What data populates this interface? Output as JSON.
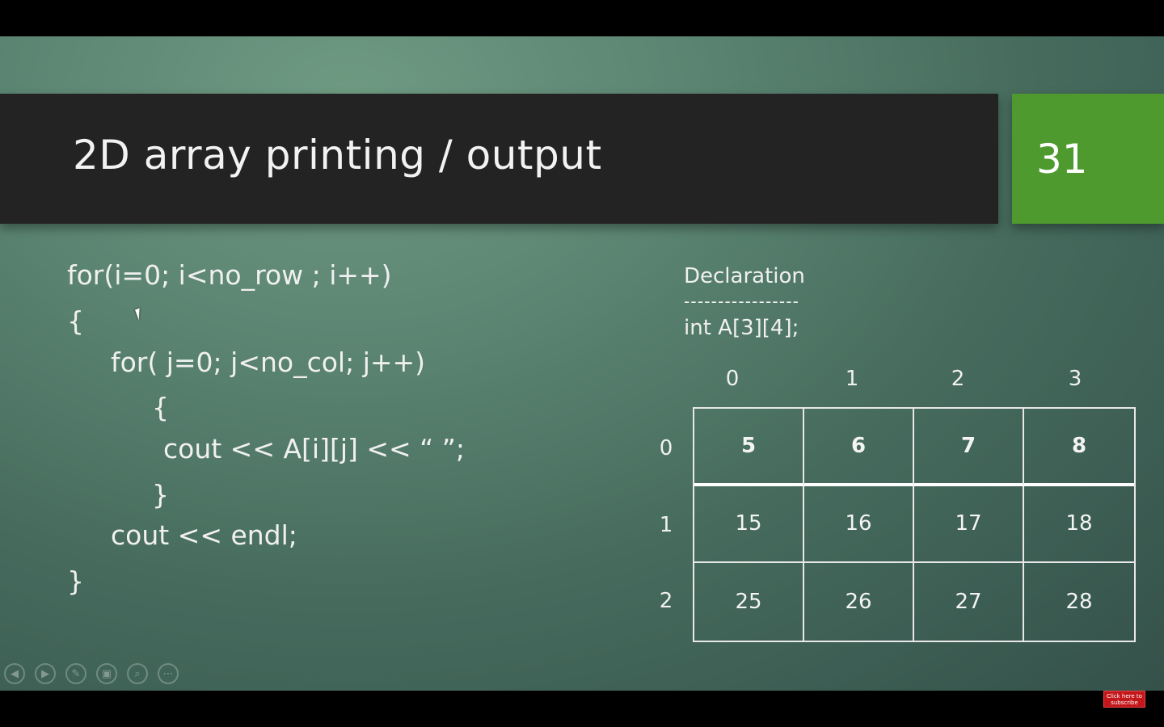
{
  "slide": {
    "title": "2D array printing / output",
    "number": "31"
  },
  "code": [
    "for(i=0; i<no_row ; i++)",
    "{",
    "for( j=0; j<no_col; j++)",
    "{",
    "cout << A[i][j] << “ ”;",
    "}",
    "cout << endl;",
    "}"
  ],
  "declaration": {
    "label": "Declaration",
    "dashes": "-----------------",
    "code": "int A[3][4];"
  },
  "array": {
    "col_indices": [
      "0",
      "1",
      "2",
      "3"
    ],
    "row_indices": [
      "0",
      "1",
      "2"
    ],
    "cells": [
      [
        "5",
        "6",
        "7",
        "8"
      ],
      [
        "15",
        "16",
        "17",
        "18"
      ],
      [
        "25",
        "26",
        "27",
        "28"
      ]
    ]
  },
  "controls": [
    {
      "name": "previous-icon",
      "glyph": "◀"
    },
    {
      "name": "next-icon",
      "glyph": "▶"
    },
    {
      "name": "pen-icon",
      "glyph": "✎"
    },
    {
      "name": "slides-icon",
      "glyph": "▣"
    },
    {
      "name": "zoom-icon",
      "glyph": "⌕"
    },
    {
      "name": "more-icon",
      "glyph": "⋯"
    }
  ],
  "subscribe": {
    "line1": "Click here to",
    "line2": "subscribe"
  },
  "colors": {
    "title_bar": "#232323",
    "number_box": "#4e9a2f",
    "subscribe": "#c3171b"
  }
}
